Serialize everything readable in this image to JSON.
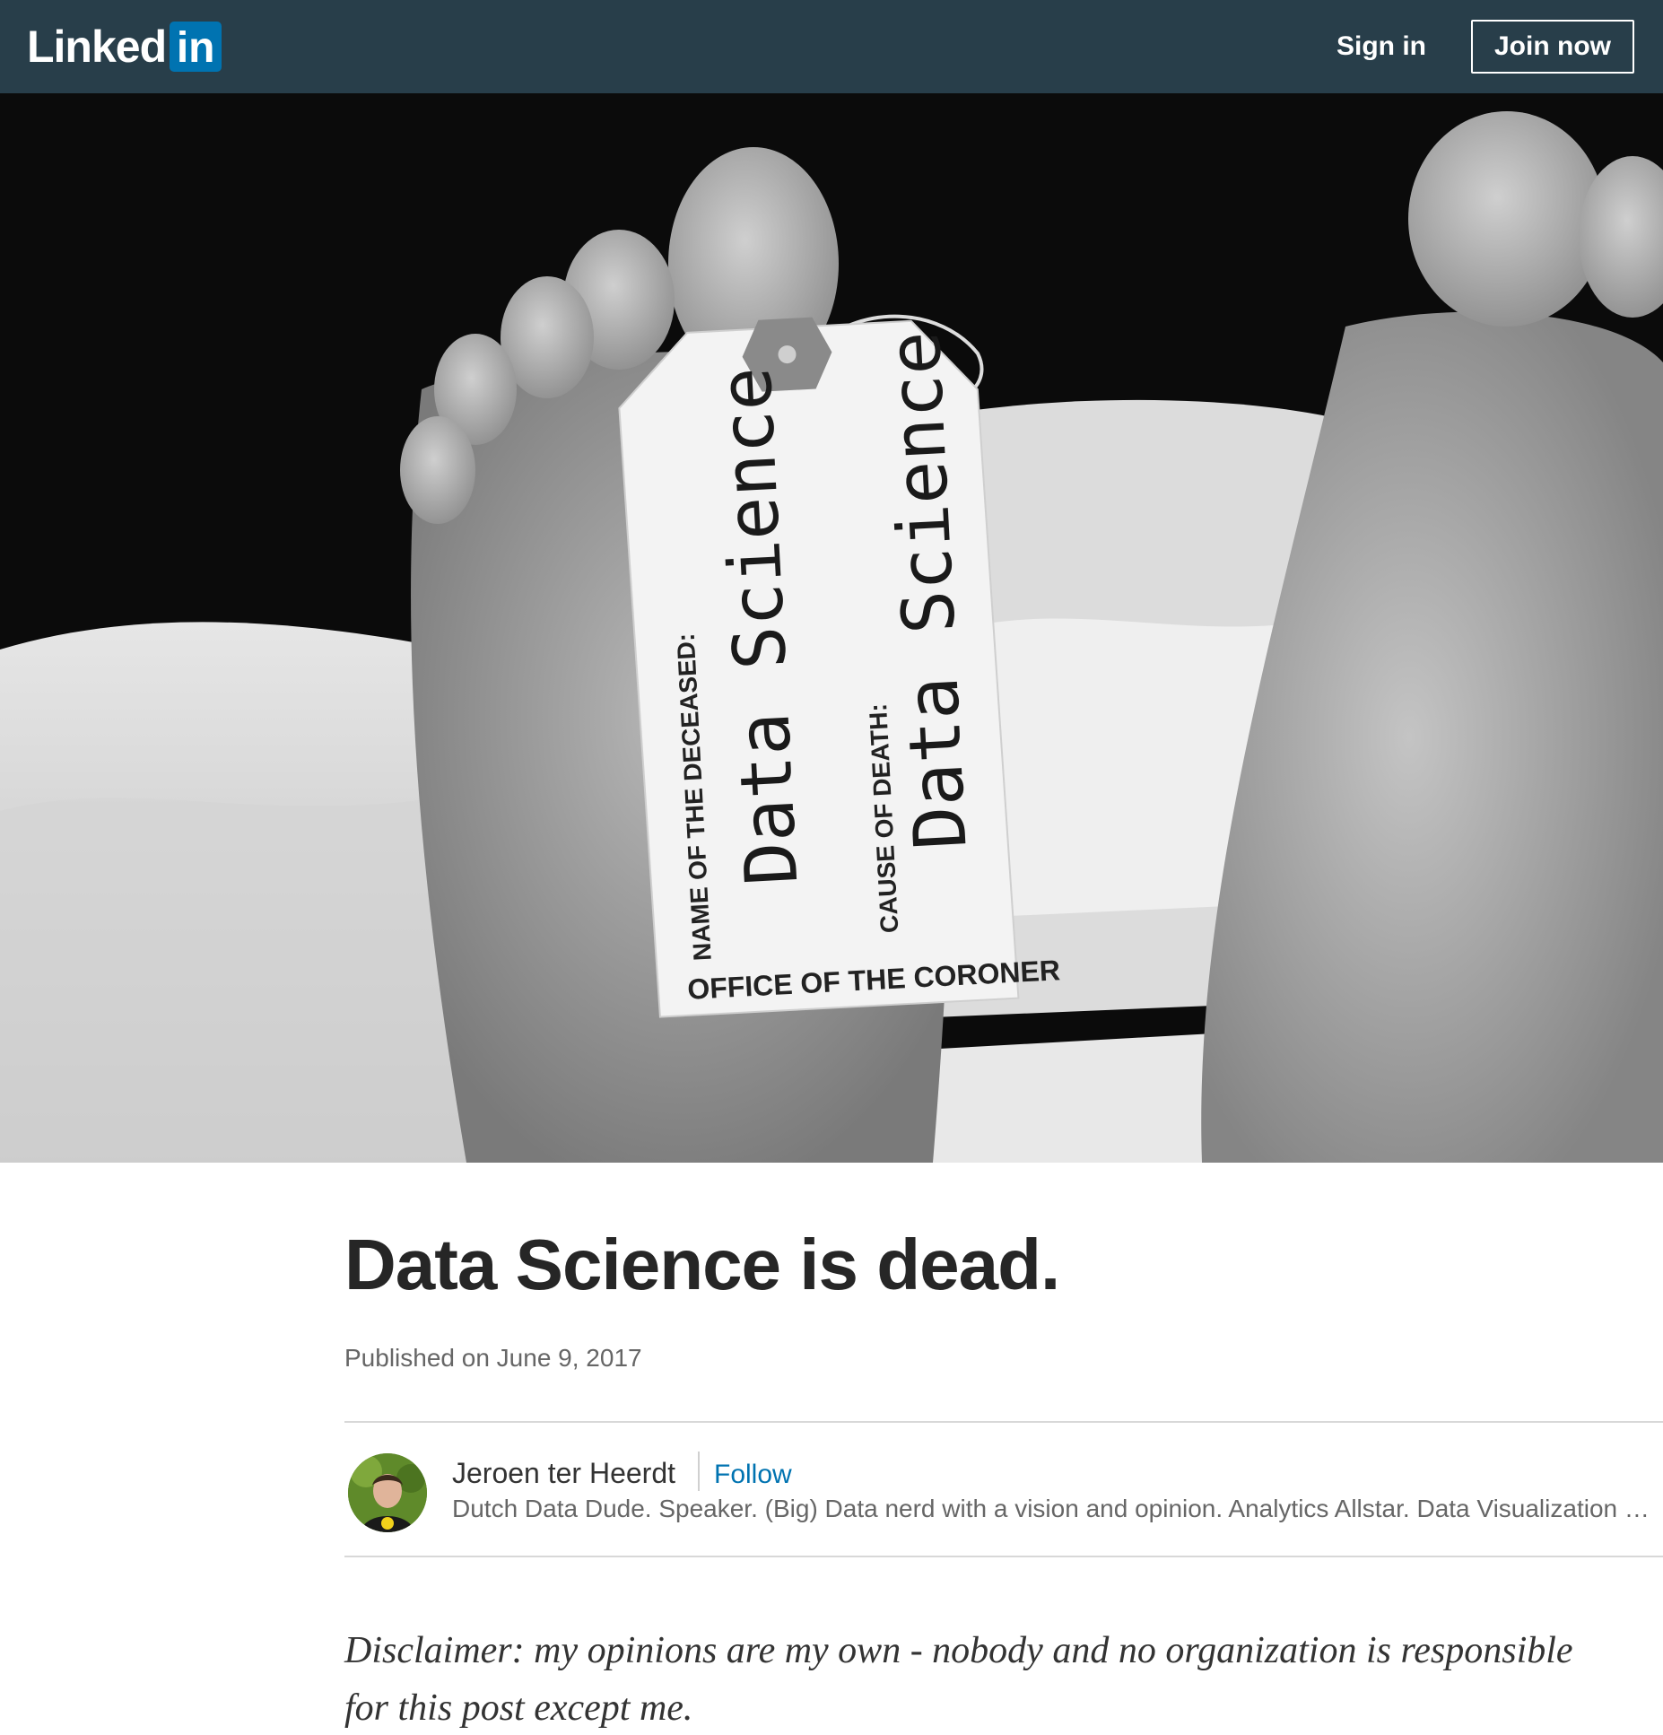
{
  "nav": {
    "logo_text": "Linked",
    "logo_box_text": "in",
    "sign_in": "Sign in",
    "join_now": "Join now",
    "colors": {
      "bar": "#283e4a",
      "logo_box": "#0073b1"
    }
  },
  "hero": {
    "tag": {
      "label_name": "NAME OF THE DECEASED:",
      "value_name": "Data Science",
      "label_cause": "CAUSE OF DEATH:",
      "value_cause": "Data Science",
      "footer": "OFFICE OF THE CORONER"
    }
  },
  "article": {
    "title": "Data Science is dead.",
    "published": "Published on June 9, 2017",
    "author": {
      "name": "Jeroen ter Heerdt",
      "follow": "Follow",
      "headline": "Dutch Data Dude. Speaker. (Big) Data nerd with a vision and opinion. Analytics Allstar. Data Visualization E…"
    },
    "disclaimer": "Disclaimer: my opinions are my own - nobody and no organization is responsible for this post except me."
  }
}
